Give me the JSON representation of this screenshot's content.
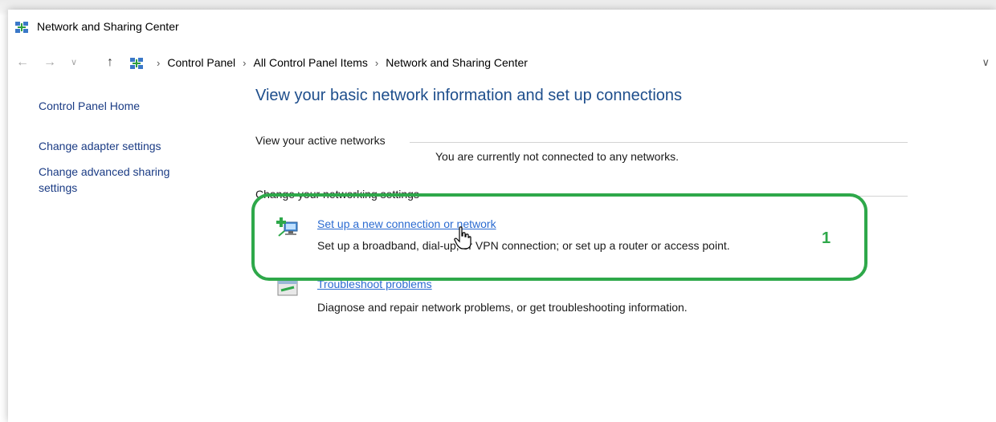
{
  "window": {
    "title": "Network and Sharing Center"
  },
  "addressbar": {
    "breadcrumbs": [
      "Control Panel",
      "All Control Panel Items",
      "Network and Sharing Center"
    ]
  },
  "sidebar": {
    "items": [
      {
        "label": "Control Panel Home"
      },
      {
        "label": "Change adapter settings"
      },
      {
        "label": "Change advanced sharing settings"
      }
    ]
  },
  "main": {
    "title": "View your basic network information and set up connections",
    "active_networks": {
      "heading": "View your active networks",
      "status": "You are currently not connected to any networks."
    },
    "networking_settings": {
      "heading": "Change your networking settings",
      "tasks": [
        {
          "link": "Set up a new connection or network",
          "description": "Set up a broadband, dial-up, or VPN connection; or set up a router or access point."
        },
        {
          "link": "Troubleshoot problems",
          "description": "Diagnose and repair network problems, or get troubleshooting information."
        }
      ]
    }
  },
  "annotation": {
    "step": "1",
    "color": "#2ea84a"
  },
  "colors": {
    "link": "#2b6bd1",
    "heading": "#1e4e8c",
    "nav_link": "#1a3b84"
  },
  "icons": {
    "window": "network-sharing-icon",
    "nav_back": "arrow-left-icon",
    "nav_forward": "arrow-right-icon",
    "recent": "chevron-down-icon",
    "up": "arrow-up-icon",
    "new_connection": "new-connection-icon",
    "troubleshoot": "troubleshoot-icon"
  }
}
